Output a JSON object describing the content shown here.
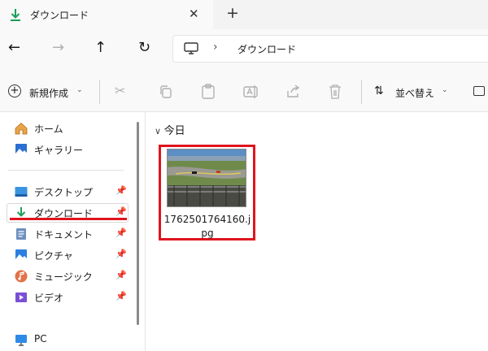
{
  "tab": {
    "title": "ダウンロード",
    "close_icon": "close-icon",
    "new_tab_icon": "plus-icon"
  },
  "nav": {
    "address_segment": "ダウンロード"
  },
  "toolbar": {
    "new_label": "新規作成",
    "sort_label": "並べ替え"
  },
  "sidebar": {
    "items": [
      {
        "label": "ホーム",
        "icon": "home-icon"
      },
      {
        "label": "ギャラリー",
        "icon": "gallery-icon"
      },
      {
        "label": "デスクトップ",
        "icon": "desktop-folder-icon",
        "pinned": true
      },
      {
        "label": "ダウンロード",
        "icon": "download-folder-icon",
        "pinned": true,
        "active": true
      },
      {
        "label": "ドキュメント",
        "icon": "documents-icon",
        "pinned": true
      },
      {
        "label": "ピクチャ",
        "icon": "pictures-icon",
        "pinned": true
      },
      {
        "label": "ミュージック",
        "icon": "music-icon",
        "pinned": true
      },
      {
        "label": "ビデオ",
        "icon": "videos-icon",
        "pinned": true
      },
      {
        "label": "PC",
        "icon": "pc-icon"
      }
    ]
  },
  "main": {
    "group_header": "今日",
    "files": [
      {
        "name": "1762501764160.jpg"
      }
    ]
  },
  "colors": {
    "highlight_red": "#e0141e",
    "download_green": "#1a9e5a"
  }
}
